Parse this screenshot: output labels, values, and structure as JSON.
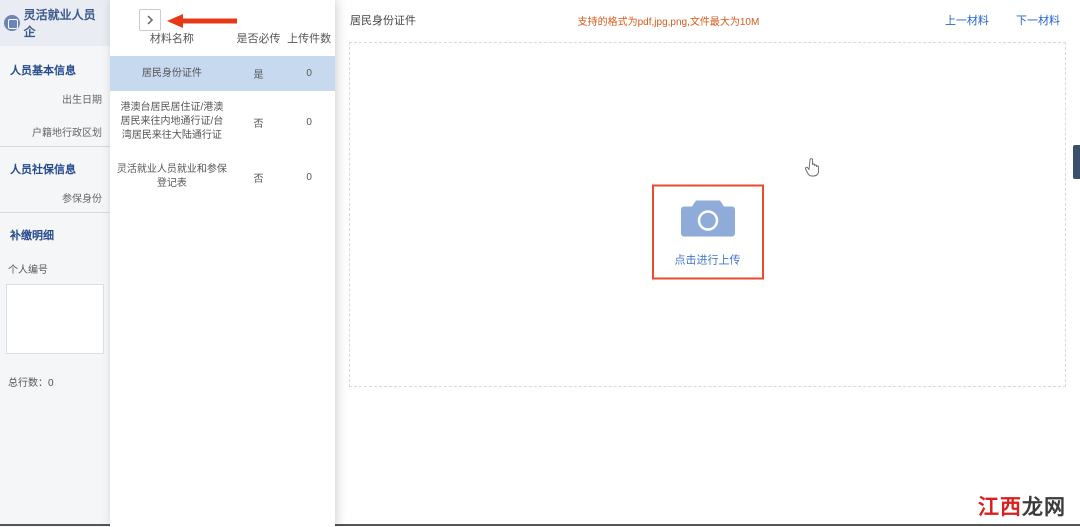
{
  "left": {
    "app_title": "灵活就业人员企",
    "sections": [
      {
        "title": "人员基本信息",
        "fields": [
          {
            "label": "出生日期"
          },
          {
            "label": "户籍地行政区划"
          }
        ]
      },
      {
        "title": "人员社保信息",
        "fields": [
          {
            "label": "参保身份"
          }
        ]
      },
      {
        "title": "补缴明细"
      }
    ],
    "personal_no_label": "个人编号",
    "total_label": "总行数：",
    "total_value": "0"
  },
  "materials": {
    "col_name": "材料名称",
    "col_required": "是否必传",
    "col_count": "上传件数",
    "rows": [
      {
        "name": "居民身份证件",
        "required": "是",
        "count": "0"
      },
      {
        "name": "港澳台居民居住证/港澳居民来往内地通行证/台湾居民来往大陆通行证",
        "required": "否",
        "count": "0"
      },
      {
        "name": "灵活就业人员就业和参保登记表",
        "required": "否",
        "count": "0"
      }
    ]
  },
  "main": {
    "doc_title": "居民身份证件",
    "format_note": "支持的格式为pdf,jpg,png,文件最大为10M",
    "prev_label": "上一材料",
    "next_label": "下一材料",
    "upload_text": "点击进行上传"
  },
  "watermark": {
    "part1": "江西",
    "part2": "龙网"
  }
}
